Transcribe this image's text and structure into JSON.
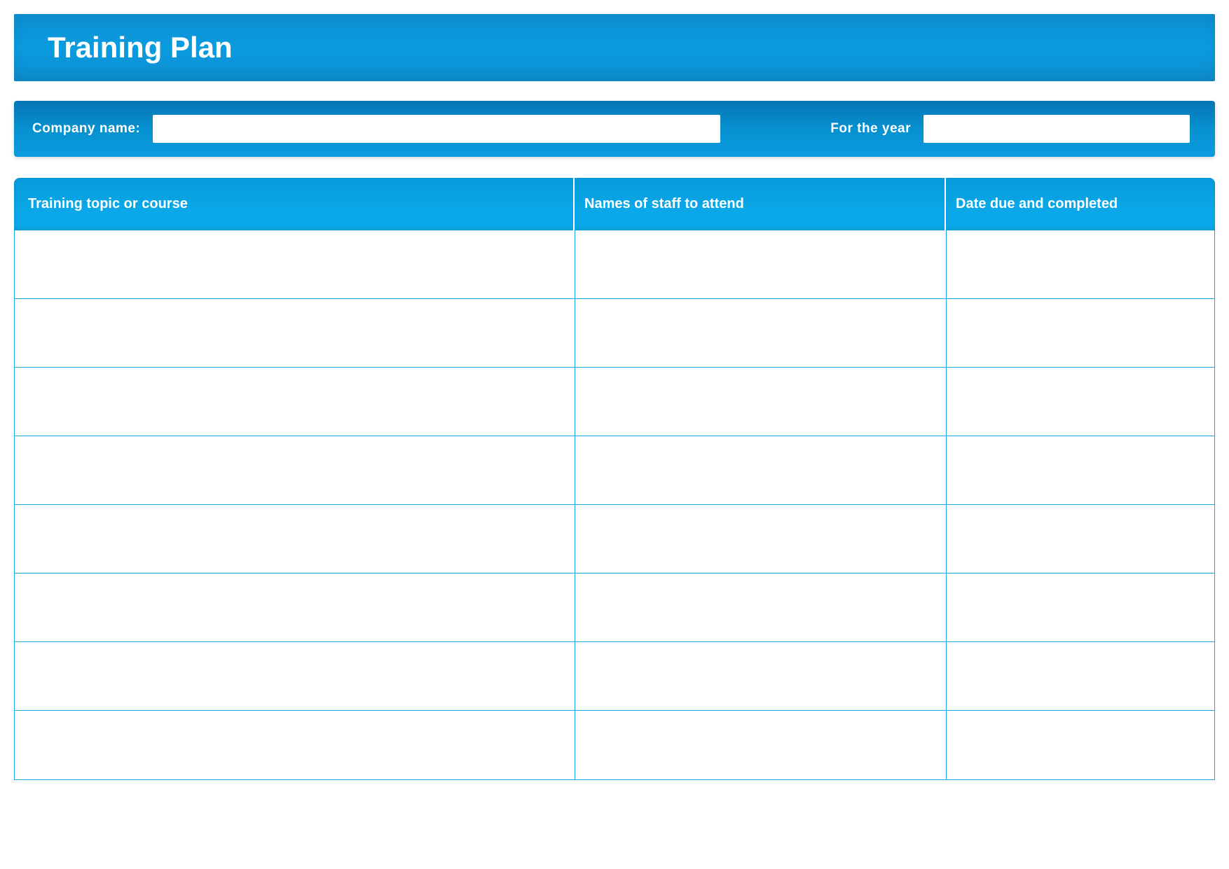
{
  "title": "Training Plan",
  "info": {
    "company_label": "Company  name:",
    "company_value": "",
    "year_label": "For the year",
    "year_value": ""
  },
  "table": {
    "headers": {
      "topic": "Training topic or course",
      "staff": "Names of staff to attend",
      "date": "Date due and completed"
    },
    "rows": [
      {
        "topic": "",
        "staff": "",
        "date": ""
      },
      {
        "topic": "",
        "staff": "",
        "date": ""
      },
      {
        "topic": "",
        "staff": "",
        "date": ""
      },
      {
        "topic": "",
        "staff": "",
        "date": ""
      },
      {
        "topic": "",
        "staff": "",
        "date": ""
      },
      {
        "topic": "",
        "staff": "",
        "date": ""
      },
      {
        "topic": "",
        "staff": "",
        "date": ""
      },
      {
        "topic": "",
        "staff": "",
        "date": ""
      }
    ]
  }
}
